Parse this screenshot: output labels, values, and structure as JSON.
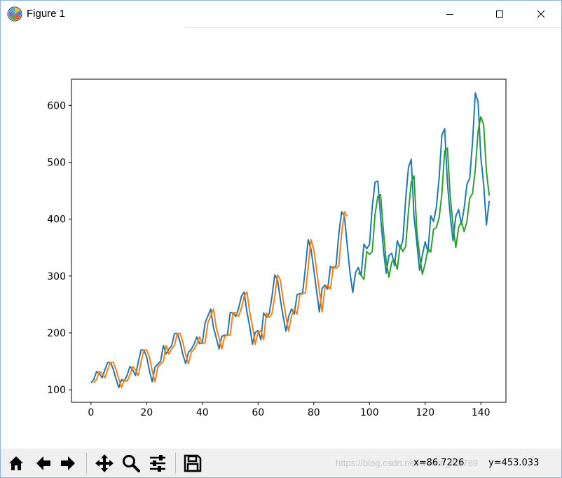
{
  "window": {
    "title": "Figure 1",
    "controls": {
      "minimize": "minimize",
      "maximize": "maximize",
      "close": "close"
    }
  },
  "toolbar": {
    "buttons": [
      {
        "name": "home-button",
        "icon": "home-icon"
      },
      {
        "name": "back-button",
        "icon": "arrow-left-icon"
      },
      {
        "name": "forward-button",
        "icon": "arrow-right-icon"
      },
      {
        "name": "pan-button",
        "icon": "move-icon"
      },
      {
        "name": "zoom-button",
        "icon": "magnifier-icon"
      },
      {
        "name": "configure-subplots-button",
        "icon": "sliders-icon"
      },
      {
        "name": "save-button",
        "icon": "floppy-disk-icon"
      }
    ],
    "coords_x": "x=86.7226",
    "coords_y": "y=453.033",
    "watermark": "https://blog.csdn.net/weixin_43/789"
  },
  "chart_data": {
    "type": "line",
    "title": "",
    "xlabel": "",
    "ylabel": "",
    "xlim": [
      -7,
      149
    ],
    "ylim": [
      78,
      646
    ],
    "xticks": [
      "0",
      "20",
      "40",
      "60",
      "80",
      "100",
      "120",
      "140"
    ],
    "yticks": [
      "100",
      "200",
      "300",
      "400",
      "500",
      "600"
    ],
    "grid": false,
    "legend": "none",
    "series": [
      {
        "color": "#1f77b4",
        "x_start": 0,
        "values": [
          112,
          118,
          132,
          129,
          121,
          135,
          148,
          148,
          136,
          119,
          104,
          118,
          115,
          126,
          141,
          135,
          125,
          149,
          170,
          170,
          158,
          133,
          114,
          140,
          145,
          150,
          178,
          163,
          172,
          178,
          199,
          199,
          184,
          162,
          146,
          166,
          171,
          180,
          193,
          181,
          183,
          218,
          230,
          242,
          209,
          191,
          172,
          194,
          196,
          196,
          236,
          235,
          229,
          243,
          264,
          272,
          237,
          211,
          180,
          201,
          204,
          188,
          235,
          227,
          234,
          264,
          302,
          293,
          259,
          229,
          203,
          229,
          242,
          233,
          267,
          269,
          270,
          315,
          364,
          347,
          312,
          274,
          237,
          278,
          284,
          277,
          317,
          313,
          318,
          374,
          413,
          405,
          355,
          306,
          271,
          306,
          315,
          301,
          356,
          348,
          355,
          422,
          465,
          467,
          404,
          347,
          305,
          336,
          340,
          318,
          362,
          348,
          363,
          435,
          491,
          505,
          404,
          359,
          310,
          337,
          360,
          342,
          406,
          396,
          420,
          472,
          548,
          559,
          463,
          407,
          362,
          405,
          417,
          391,
          419,
          461,
          472,
          535,
          622,
          606,
          508,
          461,
          390,
          432
        ]
      },
      {
        "color": "#ff7f0e",
        "x_start": 1,
        "values": [
          112,
          118,
          132,
          129,
          121,
          135,
          148,
          148,
          136,
          119,
          104,
          118,
          115,
          126,
          141,
          135,
          125,
          149,
          170,
          170,
          158,
          133,
          114,
          140,
          145,
          150,
          178,
          163,
          172,
          178,
          199,
          199,
          184,
          162,
          146,
          166,
          171,
          180,
          193,
          181,
          183,
          218,
          230,
          242,
          209,
          191,
          172,
          194,
          196,
          196,
          236,
          235,
          229,
          243,
          264,
          272,
          237,
          211,
          180,
          201,
          204,
          188,
          235,
          227,
          234,
          264,
          302,
          293,
          259,
          229,
          203,
          229,
          242,
          233,
          267,
          269,
          270,
          315,
          364,
          347,
          312,
          274,
          237,
          278,
          284,
          277,
          317,
          313,
          318,
          374,
          413,
          405
        ]
      },
      {
        "color": "#2ca02c",
        "x_start": 96,
        "values": [
          306,
          301,
          294,
          343,
          338,
          343,
          408,
          440,
          443,
          380,
          326,
          298,
          325,
          328,
          312,
          354,
          343,
          352,
          414,
          465,
          476,
          380,
          336,
          303,
          322,
          348,
          342,
          382,
          385,
          402,
          444,
          520,
          525,
          440,
          390,
          350,
          385,
          396,
          378,
          396,
          437,
          445,
          487,
          555,
          580,
          566,
          484,
          441
        ]
      }
    ]
  }
}
